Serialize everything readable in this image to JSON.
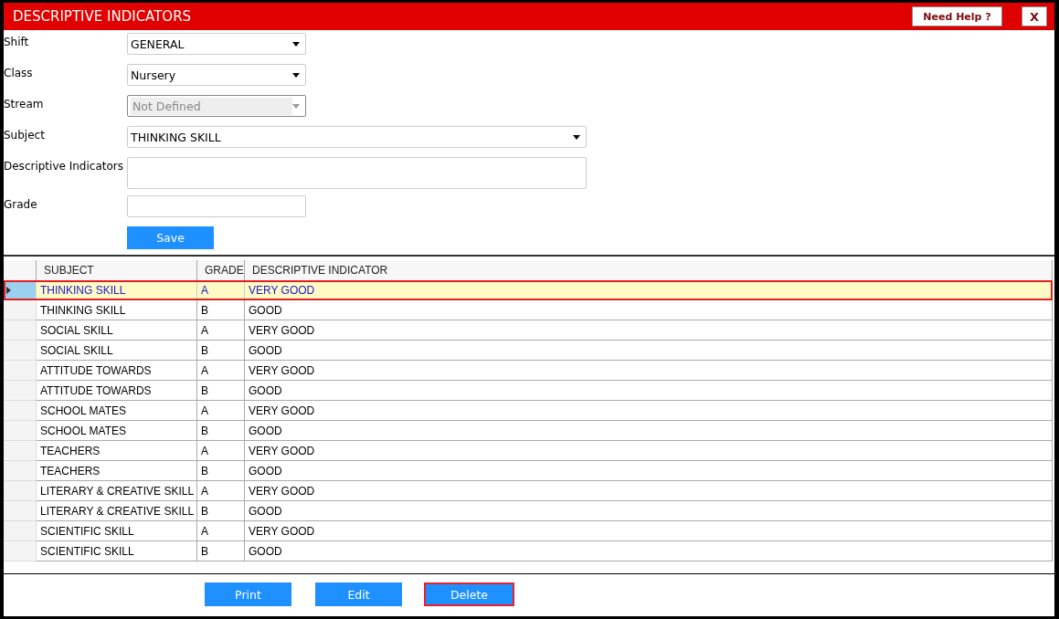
{
  "window": {
    "title": "DESCRIPTIVE INDICATORS",
    "buttons": [
      {
        "kind": "help",
        "label": "Need Help ?"
      },
      {
        "kind": "close",
        "label": "X"
      }
    ]
  },
  "form": {
    "fields": [
      {
        "kind": "dropdown",
        "label": "Shift",
        "value": "GENERAL",
        "disabled": false,
        "wide": false
      },
      {
        "kind": "dropdown",
        "label": "Class",
        "value": "Nursery",
        "disabled": false,
        "wide": false
      },
      {
        "kind": "dropdown",
        "label": "Stream",
        "value": "Not Defined",
        "disabled": true,
        "wide": false
      },
      {
        "kind": "dropdown",
        "label": "Subject",
        "value": "THINKING SKILL",
        "disabled": false,
        "wide": true
      },
      {
        "kind": "textarea",
        "label": "Descriptive Indicators",
        "disabled": false,
        "wide": true
      },
      {
        "kind": "text",
        "label": "Grade",
        "disabled": false,
        "wide": false
      }
    ],
    "save_button": "Save"
  },
  "table": {
    "columns": [
      "SUBJECT",
      "GRADE",
      "DESCRIPTIVE INDICATOR"
    ],
    "rows": [
      {
        "cells": [
          "THINKING SKILL",
          "A",
          "VERY GOOD"
        ],
        "selected": true
      },
      {
        "cells": [
          "THINKING SKILL",
          "B",
          "GOOD"
        ],
        "selected": false
      },
      {
        "cells": [
          "SOCIAL SKILL",
          "A",
          "VERY GOOD"
        ],
        "selected": false
      },
      {
        "cells": [
          "SOCIAL SKILL",
          "B",
          "GOOD"
        ],
        "selected": false
      },
      {
        "cells": [
          "ATTITUDE TOWARDS",
          "A",
          "VERY GOOD"
        ],
        "selected": false
      },
      {
        "cells": [
          "ATTITUDE TOWARDS",
          "B",
          "GOOD"
        ],
        "selected": false
      },
      {
        "cells": [
          "SCHOOL MATES",
          "A",
          "VERY GOOD"
        ],
        "selected": false
      },
      {
        "cells": [
          "SCHOOL MATES",
          "B",
          "GOOD"
        ],
        "selected": false
      },
      {
        "cells": [
          "TEACHERS",
          "A",
          "VERY GOOD"
        ],
        "selected": false
      },
      {
        "cells": [
          "TEACHERS",
          "B",
          "GOOD"
        ],
        "selected": false
      },
      {
        "cells": [
          "LITERARY & CREATIVE SKILL",
          "A",
          "VERY GOOD"
        ],
        "selected": false
      },
      {
        "cells": [
          "LITERARY & CREATIVE SKILL",
          "B",
          "GOOD"
        ],
        "selected": false
      },
      {
        "cells": [
          "SCIENTIFIC SKILL",
          "A",
          "VERY GOOD"
        ],
        "selected": false
      },
      {
        "cells": [
          "SCIENTIFIC SKILL",
          "B",
          "GOOD"
        ],
        "selected": false
      }
    ]
  },
  "actions": [
    {
      "label": "Print",
      "focused": false
    },
    {
      "label": "Edit",
      "focused": false
    },
    {
      "label": "Delete",
      "focused": true
    }
  ]
}
